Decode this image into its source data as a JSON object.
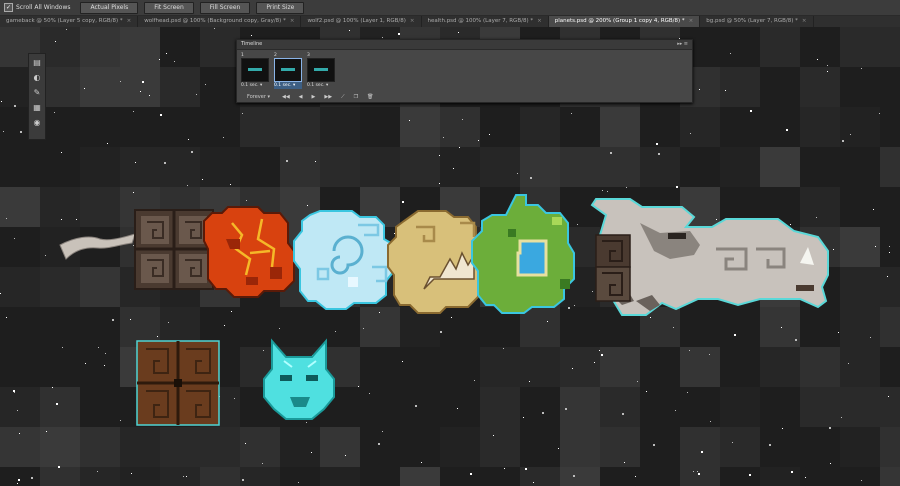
{
  "options_bar": {
    "scroll_all_windows": "Scroll All Windows",
    "buttons": [
      "Actual Pixels",
      "Fit Screen",
      "Fill Screen",
      "Print Size"
    ]
  },
  "tabs": [
    {
      "label": "gameback @ 50% (Layer 5 copy, RGB/8) *",
      "active": false
    },
    {
      "label": "wolfhead.psd @ 100% (Background copy, Gray/8) *",
      "active": false
    },
    {
      "label": "wolf2.psd @ 100% (Layer 1, RGB/8)",
      "active": false
    },
    {
      "label": "health.psd @ 100% (Layer 7, RGB/8) *",
      "active": false
    },
    {
      "label": "planets.psd @ 200% (Group 1 copy 4, RGB/8) *",
      "active": true
    },
    {
      "label": "bg.psd @ 50% (Layer 7, RGB/8) *",
      "active": false
    }
  ],
  "timeline": {
    "title": "Timeline",
    "frames": [
      {
        "number": "1",
        "delay": "0.1 sec. ▾",
        "selected": false
      },
      {
        "number": "2",
        "delay": "0.1 sec. ▾",
        "selected": true
      },
      {
        "number": "3",
        "delay": "0.1 sec. ▾",
        "selected": false
      }
    ],
    "loop": "Forever ▾",
    "controls": [
      "◀◀",
      "◀",
      "▶",
      "▶▶",
      "tween-icon",
      "new-frame-icon",
      "delete-frame-icon"
    ]
  },
  "colors": {
    "space": "#1e1e1e",
    "outline": "#4fd4d4",
    "lava": "#d8420f",
    "ice": "#bfe8f5",
    "sand": "#d8c07a",
    "grass": "#6cae3a",
    "water": "#3aa8e0",
    "rock": "#4a3a30",
    "wolf": "#c8c2bc"
  }
}
